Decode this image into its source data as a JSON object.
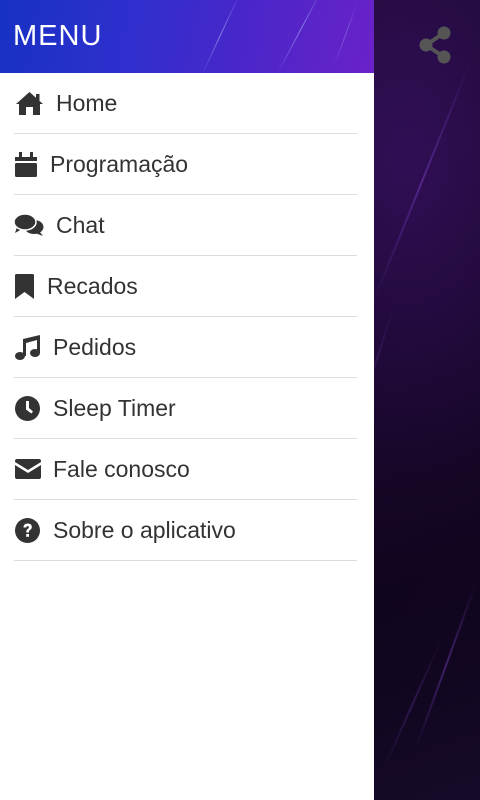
{
  "drawer": {
    "title": "MENU",
    "items": [
      {
        "label": "Home",
        "icon": "home-icon"
      },
      {
        "label": "Programação",
        "icon": "calendar-icon"
      },
      {
        "label": "Chat",
        "icon": "chat-icon"
      },
      {
        "label": "Recados",
        "icon": "bookmark-icon"
      },
      {
        "label": "Pedidos",
        "icon": "music-note-icon"
      },
      {
        "label": "Sleep Timer",
        "icon": "clock-icon"
      },
      {
        "label": "Fale conosco",
        "icon": "envelope-icon"
      },
      {
        "label": "Sobre o aplicativo",
        "icon": "question-circle-icon"
      }
    ]
  },
  "toolbar": {
    "share_icon": "share-icon"
  },
  "colors": {
    "header_start": "#1731c4",
    "header_end": "#6a22c8",
    "icon": "#333333",
    "text": "#333333",
    "divider": "#dcdcdc",
    "backdrop": "#120820"
  }
}
